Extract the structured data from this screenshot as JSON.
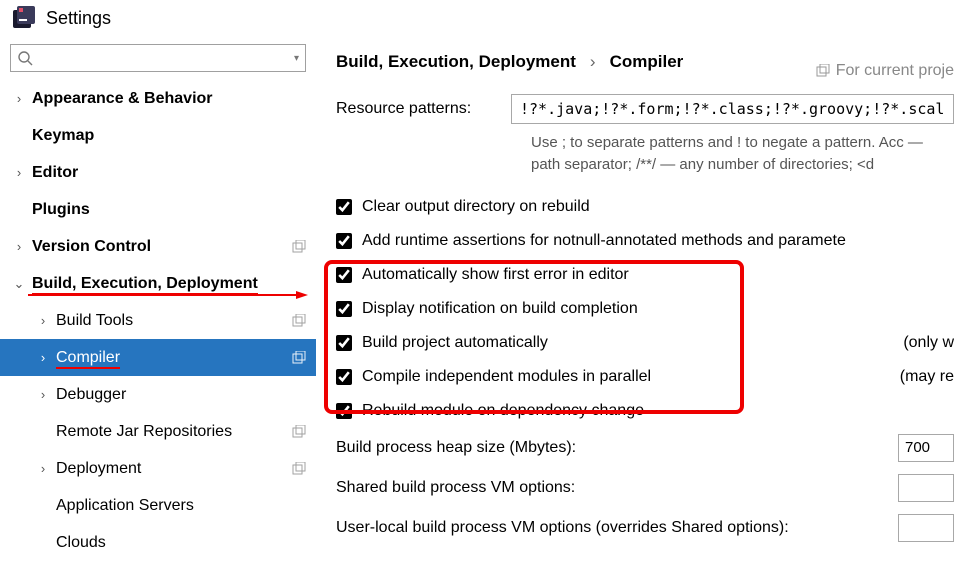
{
  "window": {
    "title": "Settings"
  },
  "search": {
    "placeholder": ""
  },
  "sidebar": {
    "items": [
      {
        "label": "Appearance & Behavior"
      },
      {
        "label": "Keymap"
      },
      {
        "label": "Editor"
      },
      {
        "label": "Plugins"
      },
      {
        "label": "Version Control"
      },
      {
        "label": "Build, Execution, Deployment"
      },
      {
        "label": "Build Tools"
      },
      {
        "label": "Compiler"
      },
      {
        "label": "Debugger"
      },
      {
        "label": "Remote Jar Repositories"
      },
      {
        "label": "Deployment"
      },
      {
        "label": "Application Servers"
      },
      {
        "label": "Clouds"
      }
    ]
  },
  "breadcrumb": {
    "a": "Build, Execution, Deployment",
    "sep": "›",
    "b": "Compiler"
  },
  "project_hint": "For current proje",
  "resource": {
    "label": "Resource patterns:",
    "value": "!?*.java;!?*.form;!?*.class;!?*.groovy;!?*.scala",
    "hint": "Use ; to separate patterns and ! to negate a pattern. Acc — path separator; /**/ — any number of directories; <d"
  },
  "checks": {
    "c1": "Clear output directory on rebuild",
    "c2": "Add runtime assertions for notnull-annotated methods and paramete",
    "c3": "Automatically show first error in editor",
    "c4": "Display notification on build completion",
    "c5": "Build project automatically",
    "c5t": "(only w",
    "c6": "Compile independent modules in parallel",
    "c6t": "(may re",
    "c7": "Rebuild module on dependency change"
  },
  "fields": {
    "heap_label": "Build process heap size (Mbytes):",
    "heap_value": "700",
    "shared_label": "Shared build process VM options:",
    "user_label": "User-local build process VM options (overrides Shared options):"
  }
}
